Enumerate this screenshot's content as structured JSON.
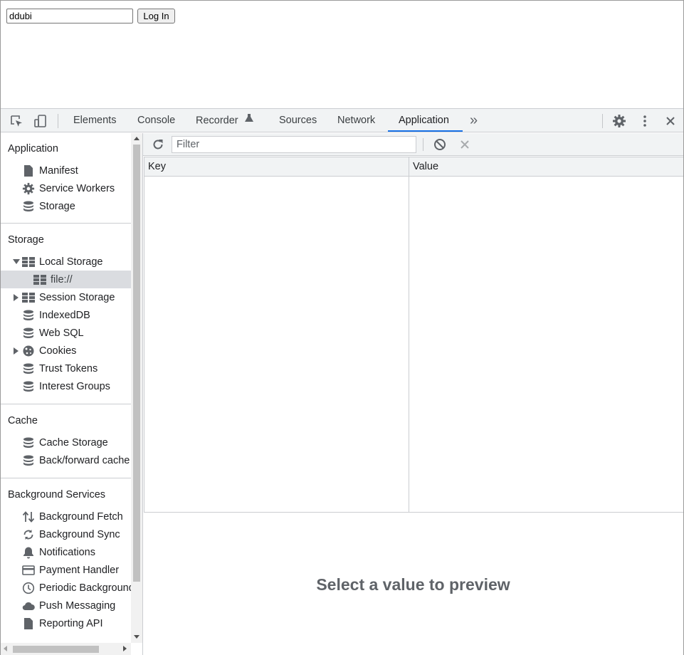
{
  "page": {
    "username_value": "ddubi",
    "login_label": "Log In"
  },
  "devtools": {
    "tabs": [
      {
        "label": "Elements"
      },
      {
        "label": "Console"
      },
      {
        "label": "Recorder"
      },
      {
        "label": "Sources"
      },
      {
        "label": "Network"
      },
      {
        "label": "Application"
      }
    ],
    "active_tab": "Application",
    "more_tabs_glyph": "»",
    "close_glyph": "✕",
    "accent_color": "#1a73e8"
  },
  "sidebar": {
    "application": {
      "title": "Application",
      "items": [
        {
          "label": "Manifest",
          "icon": "document-icon"
        },
        {
          "label": "Service Workers",
          "icon": "gear-icon"
        },
        {
          "label": "Storage",
          "icon": "database-icon"
        }
      ]
    },
    "storage": {
      "title": "Storage",
      "items": [
        {
          "label": "Local Storage",
          "icon": "table-icon",
          "expanded": true
        },
        {
          "label": "file://",
          "icon": "table-icon",
          "selected": true
        },
        {
          "label": "Session Storage",
          "icon": "table-icon",
          "expanded": false
        },
        {
          "label": "IndexedDB",
          "icon": "database-icon"
        },
        {
          "label": "Web SQL",
          "icon": "database-icon"
        },
        {
          "label": "Cookies",
          "icon": "cookie-icon",
          "expanded": false
        },
        {
          "label": "Trust Tokens",
          "icon": "database-icon"
        },
        {
          "label": "Interest Groups",
          "icon": "database-icon"
        }
      ]
    },
    "cache": {
      "title": "Cache",
      "items": [
        {
          "label": "Cache Storage",
          "icon": "database-icon"
        },
        {
          "label": "Back/forward cache",
          "icon": "database-icon"
        }
      ]
    },
    "background": {
      "title": "Background Services",
      "items": [
        {
          "label": "Background Fetch",
          "icon": "up-down-arrows-icon"
        },
        {
          "label": "Background Sync",
          "icon": "sync-icon"
        },
        {
          "label": "Notifications",
          "icon": "bell-icon"
        },
        {
          "label": "Payment Handler",
          "icon": "credit-card-icon"
        },
        {
          "label": "Periodic Background Sync",
          "icon": "clock-icon"
        },
        {
          "label": "Push Messaging",
          "icon": "cloud-icon"
        },
        {
          "label": "Reporting API",
          "icon": "document-icon"
        }
      ]
    }
  },
  "main": {
    "filter_placeholder": "Filter",
    "columns": [
      {
        "label": "Key"
      },
      {
        "label": "Value"
      }
    ],
    "rows": [],
    "preview_text": "Select a value to preview"
  }
}
